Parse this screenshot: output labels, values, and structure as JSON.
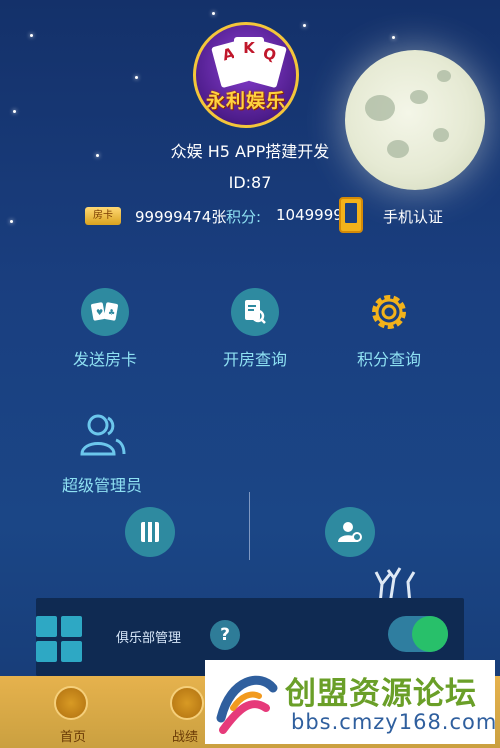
{
  "header": {
    "logo_text": "永利娱乐",
    "logo_cards": [
      "A",
      "K",
      "Q"
    ],
    "title": "众娱 H5 APP搭建开发",
    "user_id": "ID:87"
  },
  "stats": {
    "room_card_badge": "房卡",
    "room_card_value": "99999474张",
    "points_label": "积分:",
    "points_value": "1049999",
    "phone_verify_label": "手机认证"
  },
  "menu": {
    "send_card": "发送房卡",
    "room_query": "开房查询",
    "points_query": "积分查询",
    "super_admin": "超级管理员"
  },
  "bottom_bar": {
    "club_management": "俱乐部管理",
    "help_symbol": "?",
    "toggle_on": true
  },
  "nav": {
    "home": "首页",
    "record": "战绩"
  },
  "watermark": {
    "title": "创盟资源论坛",
    "url": "bbs.cmzy168.com"
  },
  "colors": {
    "accent_teal": "#2e8aa0",
    "label_cyan": "#8ee0f2",
    "gold": "#f3b21a",
    "toggle_green": "#28c06a"
  }
}
